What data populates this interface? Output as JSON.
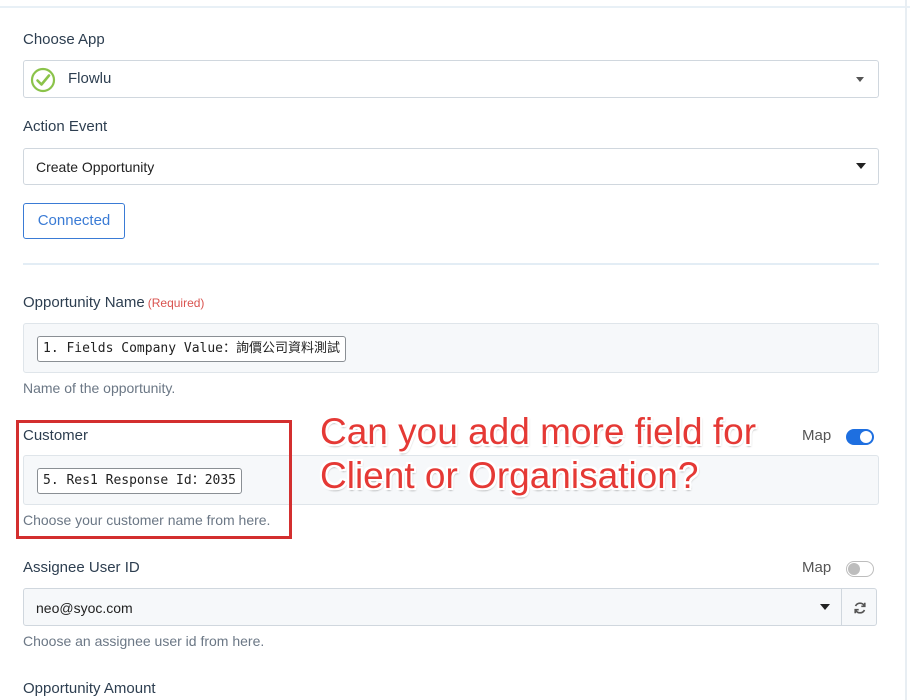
{
  "choose_app": {
    "label": "Choose App",
    "selected": "Flowlu",
    "icon": "flowlu-check-icon",
    "icon_color": "#8bc34a"
  },
  "action_event": {
    "label": "Action Event",
    "selected": "Create Opportunity"
  },
  "connected_button": "Connected",
  "opportunity_name": {
    "label": "Opportunity Name",
    "required": "(Required)",
    "token": "1. Fields Company Value：詢價公司資料測試",
    "help": "Name of the opportunity."
  },
  "customer": {
    "label": "Customer",
    "map_label": "Map",
    "map_on": true,
    "token": "5. Res1 Response Id：2035",
    "help": "Choose your customer name from here."
  },
  "assignee": {
    "label": "Assignee User ID",
    "map_label": "Map",
    "map_on": false,
    "selected": "neo@syoc.com",
    "help": "Choose an assignee user id from here."
  },
  "opportunity_amount": {
    "label": "Opportunity Amount"
  },
  "annotation": {
    "line1": "Can you add more field for",
    "line2": "Client or Organisation?",
    "color": "#e53935"
  },
  "colors": {
    "accent": "#3a7bd5",
    "toggle_on": "#1e6fe0",
    "required": "#d9534f"
  }
}
